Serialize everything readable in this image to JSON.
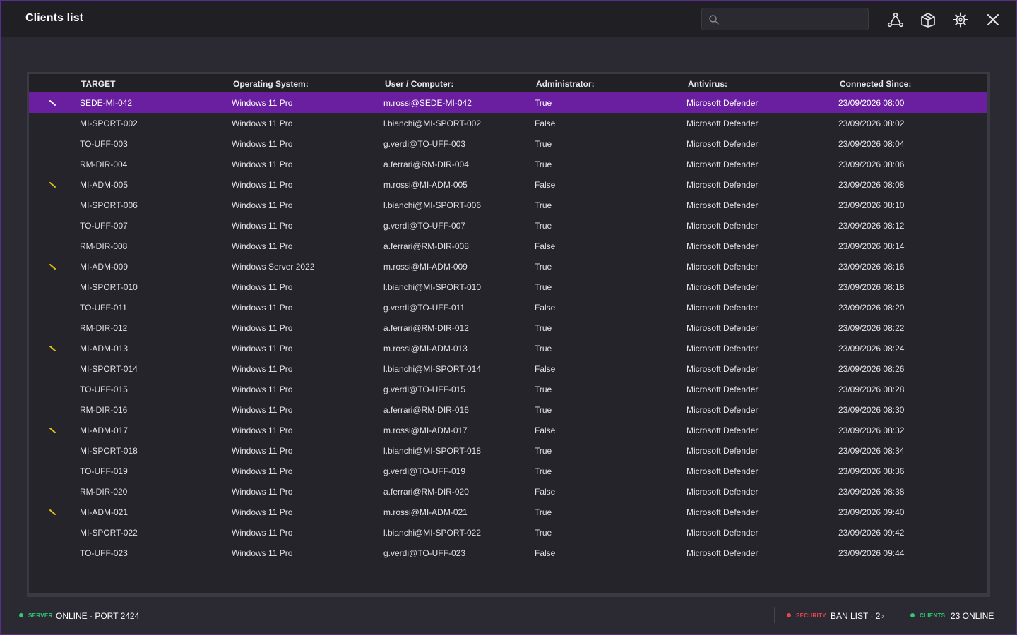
{
  "window": {
    "title": "Clients list"
  },
  "search": {
    "value": "",
    "placeholder": ""
  },
  "toolbar": {
    "icons": [
      "network-icon",
      "package-icon",
      "settings-icon",
      "close-icon"
    ]
  },
  "colors": {
    "accent": "#6a1fa0",
    "online": "#2ecc71",
    "security": "#e8454e",
    "flag": "#e6c21a"
  },
  "table": {
    "headers": [
      "TARGET",
      "Operating System:",
      "User / Computer:",
      "Administrator:",
      "Antivirus:",
      "Connected Since:"
    ],
    "rows": [
      {
        "flag": true,
        "target": "SEDE-MI-042",
        "os": "Windows 11 Pro",
        "user": "m.rossi@SEDE-MI-042",
        "admin": "True",
        "av": "Microsoft Defender",
        "since": "23/09/2026 08:00"
      },
      {
        "flag": false,
        "target": "MI-SPORT-002",
        "os": "Windows 11 Pro",
        "user": "l.bianchi@MI-SPORT-002",
        "admin": "False",
        "av": "Microsoft Defender",
        "since": "23/09/2026 08:02"
      },
      {
        "flag": false,
        "target": "TO-UFF-003",
        "os": "Windows 11 Pro",
        "user": "g.verdi@TO-UFF-003",
        "admin": "True",
        "av": "Microsoft Defender",
        "since": "23/09/2026 08:04"
      },
      {
        "flag": false,
        "target": "RM-DIR-004",
        "os": "Windows 11 Pro",
        "user": "a.ferrari@RM-DIR-004",
        "admin": "True",
        "av": "Microsoft Defender",
        "since": "23/09/2026 08:06"
      },
      {
        "flag": true,
        "target": "MI-ADM-005",
        "os": "Windows 11 Pro",
        "user": "m.rossi@MI-ADM-005",
        "admin": "False",
        "av": "Microsoft Defender",
        "since": "23/09/2026 08:08"
      },
      {
        "flag": false,
        "target": "MI-SPORT-006",
        "os": "Windows 11 Pro",
        "user": "l.bianchi@MI-SPORT-006",
        "admin": "True",
        "av": "Microsoft Defender",
        "since": "23/09/2026 08:10"
      },
      {
        "flag": false,
        "target": "TO-UFF-007",
        "os": "Windows 11 Pro",
        "user": "g.verdi@TO-UFF-007",
        "admin": "True",
        "av": "Microsoft Defender",
        "since": "23/09/2026 08:12"
      },
      {
        "flag": false,
        "target": "RM-DIR-008",
        "os": "Windows 11 Pro",
        "user": "a.ferrari@RM-DIR-008",
        "admin": "False",
        "av": "Microsoft Defender",
        "since": "23/09/2026 08:14"
      },
      {
        "flag": true,
        "target": "MI-ADM-009",
        "os": "Windows Server 2022",
        "user": "m.rossi@MI-ADM-009",
        "admin": "True",
        "av": "Microsoft Defender",
        "since": "23/09/2026 08:16"
      },
      {
        "flag": false,
        "target": "MI-SPORT-010",
        "os": "Windows 11 Pro",
        "user": "l.bianchi@MI-SPORT-010",
        "admin": "True",
        "av": "Microsoft Defender",
        "since": "23/09/2026 08:18"
      },
      {
        "flag": false,
        "target": "TO-UFF-011",
        "os": "Windows 11 Pro",
        "user": "g.verdi@TO-UFF-011",
        "admin": "False",
        "av": "Microsoft Defender",
        "since": "23/09/2026 08:20"
      },
      {
        "flag": false,
        "target": "RM-DIR-012",
        "os": "Windows 11 Pro",
        "user": "a.ferrari@RM-DIR-012",
        "admin": "True",
        "av": "Microsoft Defender",
        "since": "23/09/2026 08:22"
      },
      {
        "flag": true,
        "target": "MI-ADM-013",
        "os": "Windows 11 Pro",
        "user": "m.rossi@MI-ADM-013",
        "admin": "True",
        "av": "Microsoft Defender",
        "since": "23/09/2026 08:24"
      },
      {
        "flag": false,
        "target": "MI-SPORT-014",
        "os": "Windows 11 Pro",
        "user": "l.bianchi@MI-SPORT-014",
        "admin": "False",
        "av": "Microsoft Defender",
        "since": "23/09/2026 08:26"
      },
      {
        "flag": false,
        "target": "TO-UFF-015",
        "os": "Windows 11 Pro",
        "user": "g.verdi@TO-UFF-015",
        "admin": "True",
        "av": "Microsoft Defender",
        "since": "23/09/2026 08:28"
      },
      {
        "flag": false,
        "target": "RM-DIR-016",
        "os": "Windows 11 Pro",
        "user": "a.ferrari@RM-DIR-016",
        "admin": "True",
        "av": "Microsoft Defender",
        "since": "23/09/2026 08:30"
      },
      {
        "flag": true,
        "target": "MI-ADM-017",
        "os": "Windows 11 Pro",
        "user": "m.rossi@MI-ADM-017",
        "admin": "False",
        "av": "Microsoft Defender",
        "since": "23/09/2026 08:32"
      },
      {
        "flag": false,
        "target": "MI-SPORT-018",
        "os": "Windows 11 Pro",
        "user": "l.bianchi@MI-SPORT-018",
        "admin": "True",
        "av": "Microsoft Defender",
        "since": "23/09/2026 08:34"
      },
      {
        "flag": false,
        "target": "TO-UFF-019",
        "os": "Windows 11 Pro",
        "user": "g.verdi@TO-UFF-019",
        "admin": "True",
        "av": "Microsoft Defender",
        "since": "23/09/2026 08:36"
      },
      {
        "flag": false,
        "target": "RM-DIR-020",
        "os": "Windows 11 Pro",
        "user": "a.ferrari@RM-DIR-020",
        "admin": "False",
        "av": "Microsoft Defender",
        "since": "23/09/2026 08:38"
      },
      {
        "flag": true,
        "target": "MI-ADM-021",
        "os": "Windows 11 Pro",
        "user": "m.rossi@MI-ADM-021",
        "admin": "True",
        "av": "Microsoft Defender",
        "since": "23/09/2026 09:40"
      },
      {
        "flag": false,
        "target": "MI-SPORT-022",
        "os": "Windows 11 Pro",
        "user": "l.bianchi@MI-SPORT-022",
        "admin": "True",
        "av": "Microsoft Defender",
        "since": "23/09/2026 09:42"
      },
      {
        "flag": false,
        "target": "TO-UFF-023",
        "os": "Windows 11 Pro",
        "user": "g.verdi@TO-UFF-023",
        "admin": "False",
        "av": "Microsoft Defender",
        "since": "23/09/2026 09:44"
      }
    ],
    "selected_row": 0
  },
  "status": {
    "server_label": "SERVER",
    "server_value": "ONLINE · PORT 2424",
    "security_label": "SECURITY",
    "security_value": "BAN LIST · 2",
    "security_chevron": "›",
    "clients_label": "CLIENTS",
    "clients_value": "23 ONLINE"
  }
}
